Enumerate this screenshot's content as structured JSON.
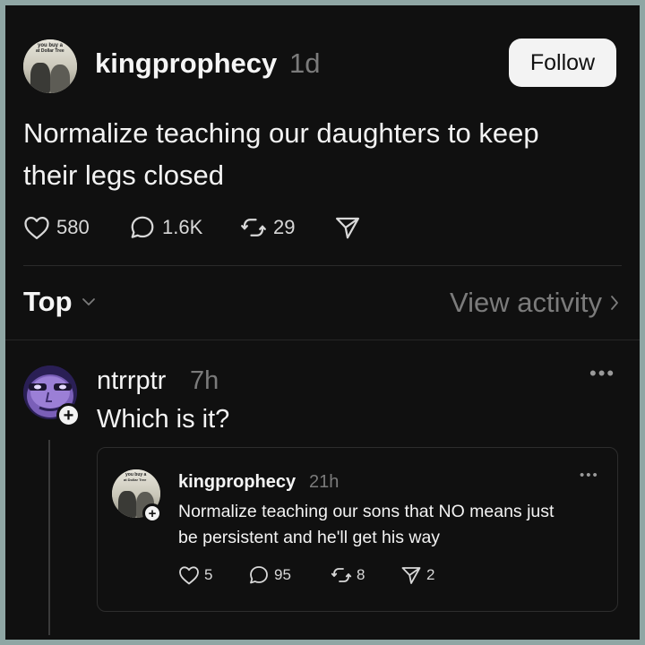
{
  "post": {
    "username": "kingprophecy",
    "time": "1d",
    "follow_label": "Follow",
    "text_line1": "Normalize teaching our daughters to keep",
    "text_line2": "their legs closed",
    "likes": "580",
    "replies": "1.6K",
    "reposts": "29",
    "avatar_text_line1": "you buy a",
    "avatar_text_line2": "at Dollar Tree"
  },
  "sort": {
    "label": "Top",
    "view_activity_label": "View activity"
  },
  "reply": {
    "username": "ntrrptr",
    "time": "7h",
    "text": "Which is it?"
  },
  "quoted": {
    "username": "kingprophecy",
    "time": "21h",
    "text_line1": "Normalize teaching our sons that NO means just",
    "text_line2": "be persistent and he'll get his way",
    "likes": "5",
    "replies": "95",
    "reposts": "8",
    "shares": "2",
    "avatar_text_line1": "you buy a",
    "avatar_text_line2": "at Dollar Tree"
  },
  "colors": {
    "background": "#101010",
    "text": "#f3f3f3",
    "muted": "#7b7b7b",
    "border": "#2d2d2d"
  },
  "icons": [
    "heart-icon",
    "comment-icon",
    "repost-icon",
    "share-icon",
    "chevron-down-icon",
    "chevron-right-icon",
    "more-icon",
    "plus-icon"
  ]
}
